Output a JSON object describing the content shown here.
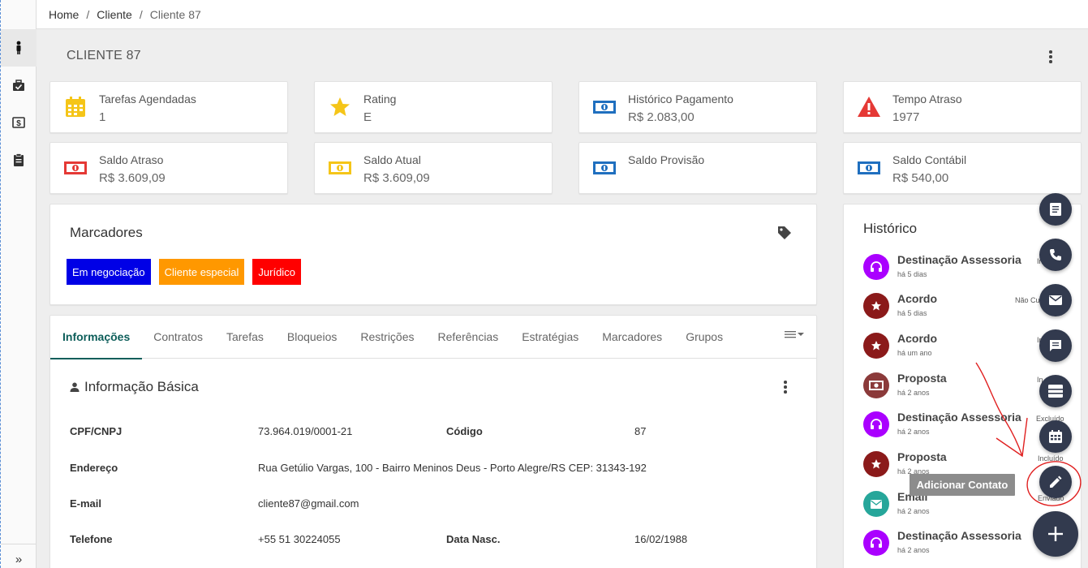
{
  "breadcrumb": {
    "home": "Home",
    "cliente": "Cliente",
    "current": "Cliente 87"
  },
  "page_title": "CLIENTE 87",
  "stats": [
    {
      "label": "Tarefas Agendadas",
      "value": "1",
      "icon": "calendar-icon",
      "color": "#f5c518"
    },
    {
      "label": "Rating",
      "value": "E",
      "icon": "star-icon",
      "color": "#f5c518"
    },
    {
      "label": "Histórico Pagamento",
      "value": "R$ 2.083,00",
      "icon": "money-icon",
      "color": "#1f6fbf"
    },
    {
      "label": "Tempo Atraso",
      "value": "1977",
      "icon": "warning-icon",
      "color": "#e53935"
    },
    {
      "label": "Saldo Atraso",
      "value": "R$ 3.609,09",
      "icon": "money-icon",
      "color": "#e53935"
    },
    {
      "label": "Saldo Atual",
      "value": "R$ 3.609,09",
      "icon": "money-icon",
      "color": "#f5c518"
    },
    {
      "label": "Saldo Provisão",
      "value": "",
      "icon": "money-icon",
      "color": "#1f6fbf"
    },
    {
      "label": "Saldo Contábil",
      "value": "R$ 540,00",
      "icon": "money-icon",
      "color": "#1f6fbf"
    }
  ],
  "marcadores": {
    "title": "Marcadores",
    "tags": [
      {
        "label": "Em negociação",
        "color": "#0000e6"
      },
      {
        "label": "Cliente especial",
        "color": "#ff9800"
      },
      {
        "label": "Jurídico",
        "color": "#ff0000"
      }
    ]
  },
  "tabs": [
    "Informações",
    "Contratos",
    "Tarefas",
    "Bloqueios",
    "Restrições",
    "Referências",
    "Estratégias",
    "Marcadores",
    "Grupos"
  ],
  "info": {
    "title": "Informação Básica",
    "cpf_label": "CPF/CNPJ",
    "cpf": "73.964.019/0001-21",
    "codigo_label": "Código",
    "codigo": "87",
    "endereco_label": "Endereço",
    "endereco": "Rua Getúlio Vargas, 100 - Bairro Meninos Deus - Porto Alegre/RS CEP: 31343-192",
    "email_label": "E-mail",
    "email": "cliente87@gmail.com",
    "telefone_label": "Telefone",
    "telefone": "+55 51 30224055",
    "nasc_label": "Data Nasc.",
    "nasc": "16/02/1988"
  },
  "historico": {
    "title": "Histórico",
    "items": [
      {
        "title": "Destinação Assessoria",
        "time": "há 5 dias",
        "status": "In",
        "icon": "headset-icon",
        "color": "#aa00ff"
      },
      {
        "title": "Acordo",
        "time": "há 5 dias",
        "status": "Não Cu",
        "icon": "star-icon",
        "color": "#8b1a1a"
      },
      {
        "title": "Acordo",
        "time": "há um ano",
        "status": "In",
        "icon": "star-icon",
        "color": "#8b1a1a"
      },
      {
        "title": "Proposta",
        "time": "há 2 anos",
        "status": "In",
        "icon": "money-icon",
        "color": "#8b3a3a"
      },
      {
        "title": "Destinação Assessoria",
        "time": "há 2 anos",
        "status": "Excluído",
        "icon": "headset-icon",
        "color": "#aa00ff"
      },
      {
        "title": "Proposta",
        "time": "há 2 anos",
        "status": "Incluído",
        "icon": "star-icon",
        "color": "#8b1a1a"
      },
      {
        "title": "Email",
        "time": "há 2 anos",
        "status": "Enviado",
        "icon": "mail-icon",
        "color": "#26a69a"
      },
      {
        "title": "Destinação Assessoria",
        "time": "há 2 anos",
        "status": "",
        "icon": "headset-icon",
        "color": "#aa00ff"
      }
    ]
  },
  "fab_tooltip": "Adicionar Contato"
}
